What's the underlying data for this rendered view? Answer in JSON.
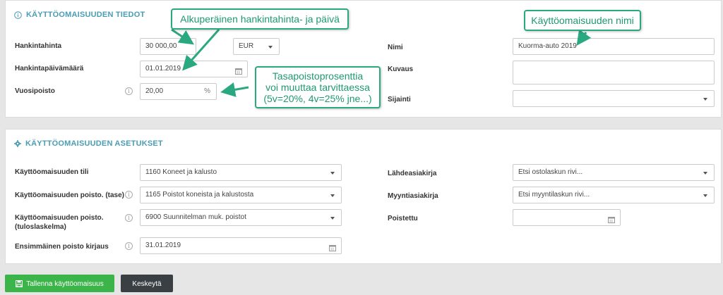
{
  "section1": {
    "title": "KÄYTTÖOMAISUUDEN TIEDOT",
    "purchase_price_label": "Hankintahinta",
    "purchase_price_value": "30 000,00",
    "currency_value": "EUR",
    "purchase_date_label": "Hankintapäivämäärä",
    "purchase_date_value": "01.01.2019",
    "depreciation_label": "Vuosipoisto",
    "depreciation_value": "20,00",
    "depreciation_unit": "%",
    "name_label": "Nimi",
    "name_value": "Kuorma-auto 2019",
    "description_label": "Kuvaus",
    "description_value": "",
    "location_label": "Sijainti",
    "location_value": ""
  },
  "section2": {
    "title": "KÄYTTÖOMAISUUDEN ASETUKSET",
    "asset_account_label": "Käyttöomaisuuden tili",
    "asset_account_value": "1160 Koneet ja kalusto",
    "depr_balance_label": "Käyttöomaisuuden poisto. (tase)",
    "depr_balance_value": "1165 Poistot koneista ja kalustosta",
    "depr_income_label_line1": "Käyttöomaisuuden poisto.",
    "depr_income_label_line2": "(tuloslaskelma)",
    "depr_income_value": "6900 Suunnitelman muk. poistot",
    "first_depr_label": "Ensimmäinen poisto kirjaus",
    "first_depr_value": "31.01.2019",
    "source_doc_label": "Lähdeasiakirja",
    "source_doc_value": "Etsi ostolaskun rivi...",
    "sales_doc_label": "Myyntiasiakirja",
    "sales_doc_value": "Etsi myyntilaskun rivi...",
    "removed_label": "Poistettu",
    "removed_value": ""
  },
  "buttons": {
    "save": "Tallenna käyttöomaisuus",
    "cancel": "Keskeytä"
  },
  "callouts": {
    "price_date": "Alkuperäinen hankintahinta- ja päivä",
    "asset_name": "Käyttöomaisuuden nimi",
    "rate_line1": "Tasapoistoprosenttia",
    "rate_line2": "voi muuttaa tarvittaessa",
    "rate_line3": "(5v=20%, 4v=25% jne...)"
  },
  "colors": {
    "accent": "#4a9db5",
    "save_button": "#3bb54a",
    "cancel_button": "#3a3f44",
    "callout": "#2aa880"
  }
}
